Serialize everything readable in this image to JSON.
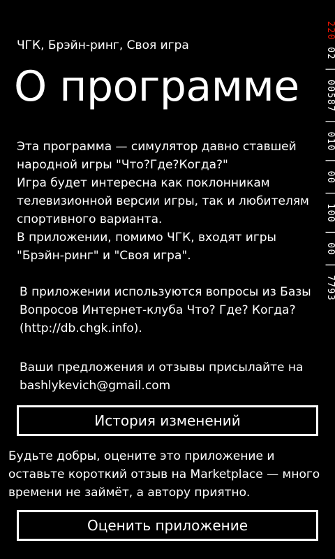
{
  "header": {
    "app_title": "ЧГК, Брэйн-ринг, Своя игра",
    "page_title": "О программе"
  },
  "content": {
    "description_lines": [
      "Эта программа — симулятор давно ставшей",
      "народной игры \"Что?Где?Когда?\"",
      "Игра будет интересна как поклонникам",
      "телевизионной версии игры, так и любителям",
      "спортивного варианта.",
      "В приложении, помимо ЧГК, входят игры",
      "\"Брэйн-ринг\" и \"Своя игра\"."
    ],
    "db_info_lines": [
      "В приложении используются вопросы из Базы",
      "Вопросов Интернет-клуба Что? Где? Когда?",
      "(http://db.chgk.info)."
    ],
    "feedback_lines": [
      "Ваши предложения и отзывы присылайте на",
      "bashlykevich@gmail.com"
    ],
    "history_button_label": "История изменений",
    "rate_text_lines": [
      "Будьте добры, оцените это приложение и",
      "оставьте короткий отзыв на Marketplace — много",
      "времени не займёт, а автору приятно."
    ],
    "rate_button_label": "Оценить приложение"
  },
  "debug_counter": {
    "accent_value": "220",
    "value": " 02 | 00587 | 010 | 00 | 100 | 00 | 7793"
  },
  "colors": {
    "background": "#000000",
    "text": "#ffffff",
    "accent": "#e51400"
  }
}
